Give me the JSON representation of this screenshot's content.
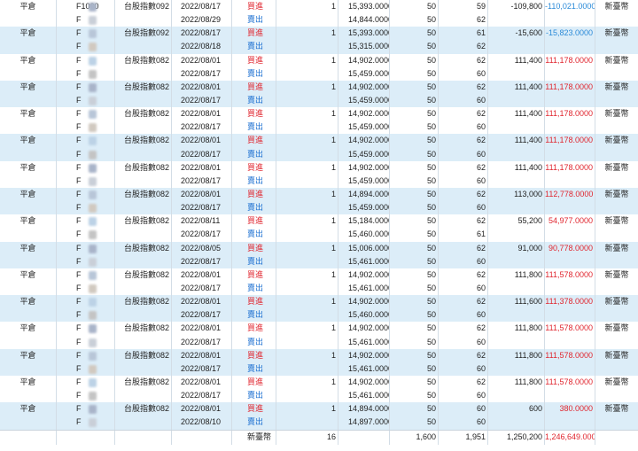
{
  "colors": {
    "alt_row": "#dcedf8",
    "buy": "#e0262f",
    "sell": "#1b6fd1",
    "pl_positive": "#e0262f",
    "pl_negative": "#2a8ad8"
  },
  "rows": [
    {
      "type": "平倉",
      "account": "F1000",
      "product": "台股指數092",
      "date": "2022/08/17",
      "side": "買進",
      "qty": "1",
      "price": "15,393.0000",
      "mult": "50",
      "days": "59",
      "pl": "-109,800",
      "net": "-110,021.0000",
      "net_sign": "neg",
      "currency": "新臺幣",
      "alt": false
    },
    {
      "type": "",
      "account": "F",
      "product": "",
      "date": "2022/08/29",
      "side": "賣出",
      "qty": "",
      "price": "14,844.0000",
      "mult": "50",
      "days": "62",
      "pl": "",
      "net": "",
      "net_sign": "",
      "currency": "",
      "alt": false
    },
    {
      "type": "平倉",
      "account": "F",
      "product": "台股指數092",
      "date": "2022/08/17",
      "side": "買進",
      "qty": "1",
      "price": "15,393.0000",
      "mult": "50",
      "days": "61",
      "pl": "-15,600",
      "net": "-15,823.0000",
      "net_sign": "neg",
      "currency": "新臺幣",
      "alt": true
    },
    {
      "type": "",
      "account": "F",
      "product": "",
      "date": "2022/08/18",
      "side": "賣出",
      "qty": "",
      "price": "15,315.0000",
      "mult": "50",
      "days": "62",
      "pl": "",
      "net": "",
      "net_sign": "",
      "currency": "",
      "alt": true
    },
    {
      "type": "平倉",
      "account": "F",
      "product": "台股指數082",
      "date": "2022/08/01",
      "side": "買進",
      "qty": "1",
      "price": "14,902.0000",
      "mult": "50",
      "days": "62",
      "pl": "111,400",
      "net": "111,178.0000",
      "net_sign": "pos",
      "currency": "新臺幣",
      "alt": false
    },
    {
      "type": "",
      "account": "F",
      "product": "",
      "date": "2022/08/17",
      "side": "賣出",
      "qty": "",
      "price": "15,459.0000",
      "mult": "50",
      "days": "60",
      "pl": "",
      "net": "",
      "net_sign": "",
      "currency": "",
      "alt": false
    },
    {
      "type": "平倉",
      "account": "F",
      "product": "台股指數082",
      "date": "2022/08/01",
      "side": "買進",
      "qty": "1",
      "price": "14,902.0000",
      "mult": "50",
      "days": "62",
      "pl": "111,400",
      "net": "111,178.0000",
      "net_sign": "pos",
      "currency": "新臺幣",
      "alt": true
    },
    {
      "type": "",
      "account": "F",
      "product": "",
      "date": "2022/08/17",
      "side": "賣出",
      "qty": "",
      "price": "15,459.0000",
      "mult": "50",
      "days": "60",
      "pl": "",
      "net": "",
      "net_sign": "",
      "currency": "",
      "alt": true
    },
    {
      "type": "平倉",
      "account": "F",
      "product": "台股指數082",
      "date": "2022/08/01",
      "side": "買進",
      "qty": "1",
      "price": "14,902.0000",
      "mult": "50",
      "days": "62",
      "pl": "111,400",
      "net": "111,178.0000",
      "net_sign": "pos",
      "currency": "新臺幣",
      "alt": false
    },
    {
      "type": "",
      "account": "F",
      "product": "",
      "date": "2022/08/17",
      "side": "賣出",
      "qty": "",
      "price": "15,459.0000",
      "mult": "50",
      "days": "60",
      "pl": "",
      "net": "",
      "net_sign": "",
      "currency": "",
      "alt": false
    },
    {
      "type": "平倉",
      "account": "F",
      "product": "台股指數082",
      "date": "2022/08/01",
      "side": "買進",
      "qty": "1",
      "price": "14,902.0000",
      "mult": "50",
      "days": "62",
      "pl": "111,400",
      "net": "111,178.0000",
      "net_sign": "pos",
      "currency": "新臺幣",
      "alt": true
    },
    {
      "type": "",
      "account": "F",
      "product": "",
      "date": "2022/08/17",
      "side": "賣出",
      "qty": "",
      "price": "15,459.0000",
      "mult": "50",
      "days": "60",
      "pl": "",
      "net": "",
      "net_sign": "",
      "currency": "",
      "alt": true
    },
    {
      "type": "平倉",
      "account": "F",
      "product": "台股指數082",
      "date": "2022/08/01",
      "side": "買進",
      "qty": "1",
      "price": "14,902.0000",
      "mult": "50",
      "days": "62",
      "pl": "111,400",
      "net": "111,178.0000",
      "net_sign": "pos",
      "currency": "新臺幣",
      "alt": false
    },
    {
      "type": "",
      "account": "F",
      "product": "",
      "date": "2022/08/17",
      "side": "賣出",
      "qty": "",
      "price": "15,459.0000",
      "mult": "50",
      "days": "60",
      "pl": "",
      "net": "",
      "net_sign": "",
      "currency": "",
      "alt": false
    },
    {
      "type": "平倉",
      "account": "F",
      "product": "台股指數082",
      "date": "2022/08/01",
      "side": "買進",
      "qty": "1",
      "price": "14,894.0000",
      "mult": "50",
      "days": "62",
      "pl": "113,000",
      "net": "112,778.0000",
      "net_sign": "pos",
      "currency": "新臺幣",
      "alt": true
    },
    {
      "type": "",
      "account": "F",
      "product": "",
      "date": "2022/08/17",
      "side": "賣出",
      "qty": "",
      "price": "15,459.0000",
      "mult": "50",
      "days": "60",
      "pl": "",
      "net": "",
      "net_sign": "",
      "currency": "",
      "alt": true
    },
    {
      "type": "平倉",
      "account": "F",
      "product": "台股指數082",
      "date": "2022/08/11",
      "side": "買進",
      "qty": "1",
      "price": "15,184.0000",
      "mult": "50",
      "days": "62",
      "pl": "55,200",
      "net": "54,977.0000",
      "net_sign": "pos",
      "currency": "新臺幣",
      "alt": false
    },
    {
      "type": "",
      "account": "F",
      "product": "",
      "date": "2022/08/17",
      "side": "賣出",
      "qty": "",
      "price": "15,460.0000",
      "mult": "50",
      "days": "61",
      "pl": "",
      "net": "",
      "net_sign": "",
      "currency": "",
      "alt": false
    },
    {
      "type": "平倉",
      "account": "F",
      "product": "台股指數082",
      "date": "2022/08/05",
      "side": "買進",
      "qty": "1",
      "price": "15,006.0000",
      "mult": "50",
      "days": "62",
      "pl": "91,000",
      "net": "90,778.0000",
      "net_sign": "pos",
      "currency": "新臺幣",
      "alt": true
    },
    {
      "type": "",
      "account": "F",
      "product": "",
      "date": "2022/08/17",
      "side": "賣出",
      "qty": "",
      "price": "15,461.0000",
      "mult": "50",
      "days": "60",
      "pl": "",
      "net": "",
      "net_sign": "",
      "currency": "",
      "alt": true
    },
    {
      "type": "平倉",
      "account": "F",
      "product": "台股指數082",
      "date": "2022/08/01",
      "side": "買進",
      "qty": "1",
      "price": "14,902.0000",
      "mult": "50",
      "days": "62",
      "pl": "111,800",
      "net": "111,578.0000",
      "net_sign": "pos",
      "currency": "新臺幣",
      "alt": false
    },
    {
      "type": "",
      "account": "F",
      "product": "",
      "date": "2022/08/17",
      "side": "賣出",
      "qty": "",
      "price": "15,461.0000",
      "mult": "50",
      "days": "60",
      "pl": "",
      "net": "",
      "net_sign": "",
      "currency": "",
      "alt": false
    },
    {
      "type": "平倉",
      "account": "F",
      "product": "台股指數082",
      "date": "2022/08/01",
      "side": "買進",
      "qty": "1",
      "price": "14,902.0000",
      "mult": "50",
      "days": "62",
      "pl": "111,600",
      "net": "111,378.0000",
      "net_sign": "pos",
      "currency": "新臺幣",
      "alt": true
    },
    {
      "type": "",
      "account": "F",
      "product": "",
      "date": "2022/08/17",
      "side": "賣出",
      "qty": "",
      "price": "15,460.0000",
      "mult": "50",
      "days": "60",
      "pl": "",
      "net": "",
      "net_sign": "",
      "currency": "",
      "alt": true
    },
    {
      "type": "平倉",
      "account": "F",
      "product": "台股指數082",
      "date": "2022/08/01",
      "side": "買進",
      "qty": "1",
      "price": "14,902.0000",
      "mult": "50",
      "days": "62",
      "pl": "111,800",
      "net": "111,578.0000",
      "net_sign": "pos",
      "currency": "新臺幣",
      "alt": false
    },
    {
      "type": "",
      "account": "F",
      "product": "",
      "date": "2022/08/17",
      "side": "賣出",
      "qty": "",
      "price": "15,461.0000",
      "mult": "50",
      "days": "60",
      "pl": "",
      "net": "",
      "net_sign": "",
      "currency": "",
      "alt": false
    },
    {
      "type": "平倉",
      "account": "F",
      "product": "台股指數082",
      "date": "2022/08/01",
      "side": "買進",
      "qty": "1",
      "price": "14,902.0000",
      "mult": "50",
      "days": "62",
      "pl": "111,800",
      "net": "111,578.0000",
      "net_sign": "pos",
      "currency": "新臺幣",
      "alt": true
    },
    {
      "type": "",
      "account": "F",
      "product": "",
      "date": "2022/08/17",
      "side": "賣出",
      "qty": "",
      "price": "15,461.0000",
      "mult": "50",
      "days": "60",
      "pl": "",
      "net": "",
      "net_sign": "",
      "currency": "",
      "alt": true
    },
    {
      "type": "平倉",
      "account": "F",
      "product": "台股指數082",
      "date": "2022/08/01",
      "side": "買進",
      "qty": "1",
      "price": "14,902.0000",
      "mult": "50",
      "days": "62",
      "pl": "111,800",
      "net": "111,578.0000",
      "net_sign": "pos",
      "currency": "新臺幣",
      "alt": false
    },
    {
      "type": "",
      "account": "F",
      "product": "",
      "date": "2022/08/17",
      "side": "賣出",
      "qty": "",
      "price": "15,461.0000",
      "mult": "50",
      "days": "60",
      "pl": "",
      "net": "",
      "net_sign": "",
      "currency": "",
      "alt": false
    },
    {
      "type": "平倉",
      "account": "F",
      "product": "台股指數082",
      "date": "2022/08/01",
      "side": "買進",
      "qty": "1",
      "price": "14,894.0000",
      "mult": "50",
      "days": "60",
      "pl": "600",
      "net": "380.0000",
      "net_sign": "pos",
      "currency": "新臺幣",
      "alt": true
    },
    {
      "type": "",
      "account": "F",
      "product": "",
      "date": "2022/08/10",
      "side": "賣出",
      "qty": "",
      "price": "14,897.0000",
      "mult": "50",
      "days": "60",
      "pl": "",
      "net": "",
      "net_sign": "",
      "currency": "",
      "alt": true
    }
  ],
  "total": {
    "currency_label": "新臺幣",
    "qty": "16",
    "mult": "1,600",
    "days": "1,951",
    "pl": "1,250,200",
    "net": "1,246,649.0000"
  }
}
